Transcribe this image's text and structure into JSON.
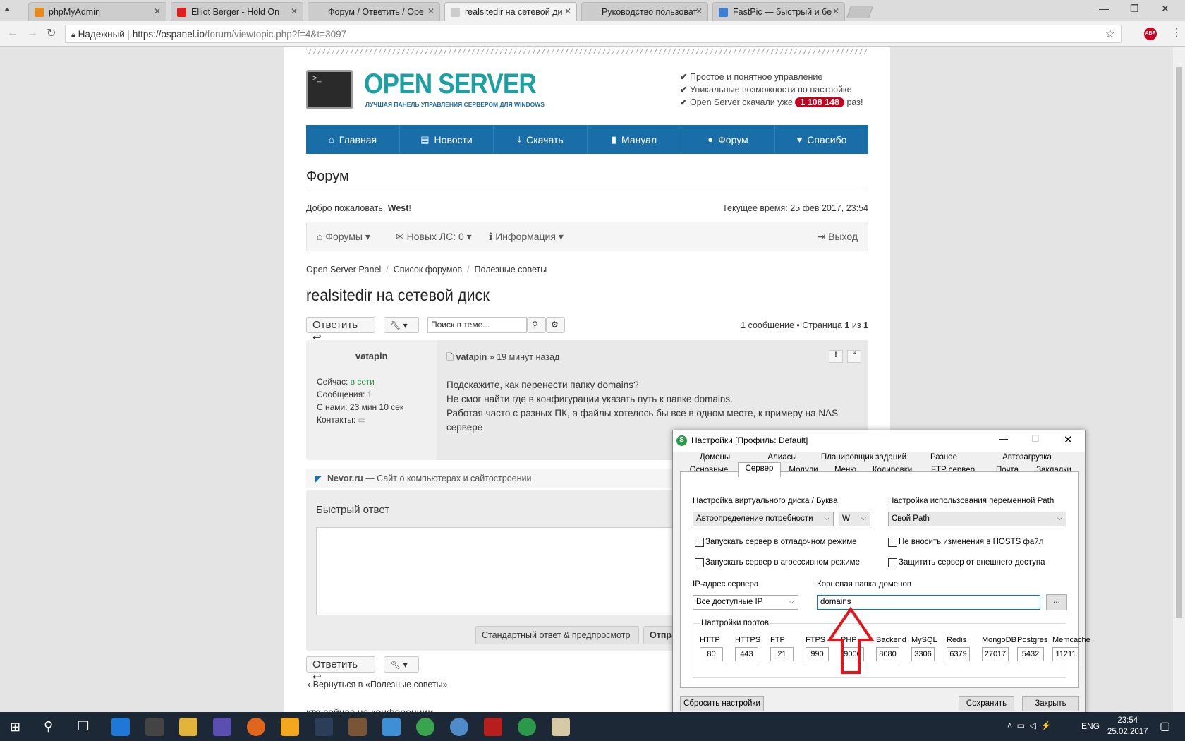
{
  "browser": {
    "tabs": [
      {
        "title": "phpMyAdmin",
        "color": "#e88a1a"
      },
      {
        "title": "Elliot Berger - Hold On",
        "color": "#e02020"
      },
      {
        "title": "Форум / Ответить / Ope",
        "color": "#cccccc"
      },
      {
        "title": "realsitedir на сетевой ди",
        "color": "#cccccc"
      },
      {
        "title": "Руководство пользоват",
        "color": "#cccccc"
      },
      {
        "title": "FastPic — быстрый и бе",
        "color": "#3a7fd5"
      }
    ],
    "secure_label": "Надежный",
    "url_host": "https://ospanel.io",
    "url_path": "/forum/viewtopic.php?f=4&t=3097",
    "abp": "ABP"
  },
  "site": {
    "logo_title": "OPEN SERVER",
    "logo_sub": "ЛУЧШАЯ ПАНЕЛЬ УПРАВЛЕНИЯ СЕРВЕРОМ ДЛЯ WINDOWS",
    "features": [
      "Простое и понятное управление",
      "Уникальные возможности по настройке"
    ],
    "downloads_prefix": "Open Server скачали уже",
    "downloads_count": "1 108 148",
    "downloads_suffix": "раз!",
    "nav": [
      {
        "label": "Главная",
        "icon": "⌂"
      },
      {
        "label": "Новости",
        "icon": "▤"
      },
      {
        "label": "Скачать",
        "icon": "⤓"
      },
      {
        "label": "Мануал",
        "icon": "▮"
      },
      {
        "label": "Форум",
        "icon": "●"
      },
      {
        "label": "Спасибо",
        "icon": "♥"
      }
    ]
  },
  "forum": {
    "heading": "Форум",
    "welcome": "Добро пожаловать,",
    "user": "West",
    "current_time": "Текущее время: 25 фев 2017, 23:54",
    "usernav": {
      "forums": "Форумы",
      "pm": "Новых ЛС: 0",
      "info": "Информация",
      "logout": "Выход"
    },
    "breadcrumbs": [
      "Open Server Panel",
      "Список форумов",
      "Полезные советы"
    ],
    "topic_title": "realsitedir на сетевой диск",
    "reply_btn": "Ответить",
    "search_placeholder": "Поиск в теме...",
    "pagination_text": "1 сообщение • Страница",
    "page": "1",
    "of": "из",
    "total": "1",
    "post": {
      "author": "vatapin",
      "status_label": "Сейчас:",
      "status_value": "в сети",
      "messages": "Сообщения: 1",
      "with_us": "С нами: 23 мин 10 сек",
      "contacts": "Контакты:",
      "time": "» 19 минут назад",
      "lines": [
        "Подскажите, как перенести папку domains?",
        "Не смог найти где в конфигурации указать путь к папке domains.",
        "Работая часто с разных ПК, а файлы хотелось бы все в одном месте, к примеру на NAS",
        "сервере"
      ]
    },
    "ad_site": "Nevor.ru",
    "ad_text": "— Сайт о компьютерах и сайтостроении",
    "quick_reply": "Быстрый ответ",
    "preview_btn": "Стандартный ответ & предпросмотр",
    "send_btn": "Отпра",
    "back_link": "Вернуться в «Полезные советы»",
    "footer_partial": "кто сейчас на конференции"
  },
  "dialog": {
    "title": "Настройки [Профиль: Default]",
    "tabs_row1": [
      "Домены",
      "Алиасы",
      "Планировщик заданий",
      "Разное",
      "Автозагрузка"
    ],
    "tabs_row2": [
      "Основные",
      "Сервер",
      "Модули",
      "Меню",
      "Кодировки",
      "FTP сервер",
      "Почта",
      "Закладки"
    ],
    "vdisk_label": "Настройка виртуального диска / Буква",
    "vdisk_value": "Автоопределение потребности",
    "vdisk_letter": "W",
    "path_label": "Настройка использования переменной Path",
    "path_value": "Свой Path",
    "cb_debug": "Запускать сервер в отладочном режиме",
    "cb_aggressive": "Запускать сервер в агрессивном режиме",
    "cb_hosts": "Не вносить изменения в HOSTS файл",
    "cb_protect": "Защитить сервер от внешнего доступа",
    "ip_label": "IP-адрес сервера",
    "ip_value": "Все доступные IP",
    "root_label": "Корневая папка доменов",
    "root_value": "domains",
    "browse": "...",
    "ports_label": "Настройки портов",
    "ports": [
      {
        "name": "HTTP",
        "value": "80"
      },
      {
        "name": "HTTPS",
        "value": "443"
      },
      {
        "name": "FTP",
        "value": "21"
      },
      {
        "name": "FTPS",
        "value": "990"
      },
      {
        "name": "PHP",
        "value": "9000"
      },
      {
        "name": "Backend",
        "value": "8080"
      },
      {
        "name": "MySQL",
        "value": "3306"
      },
      {
        "name": "Redis",
        "value": "6379"
      },
      {
        "name": "MongoDB",
        "value": "27017"
      },
      {
        "name": "Postgres",
        "value": "5432"
      },
      {
        "name": "Memcache",
        "value": "11211"
      }
    ],
    "reset": "Сбросить настройки",
    "save": "Сохранить",
    "close": "Закрыть"
  },
  "taskbar": {
    "lang": "ENG",
    "time": "23:54",
    "date": "25.02.2017"
  }
}
